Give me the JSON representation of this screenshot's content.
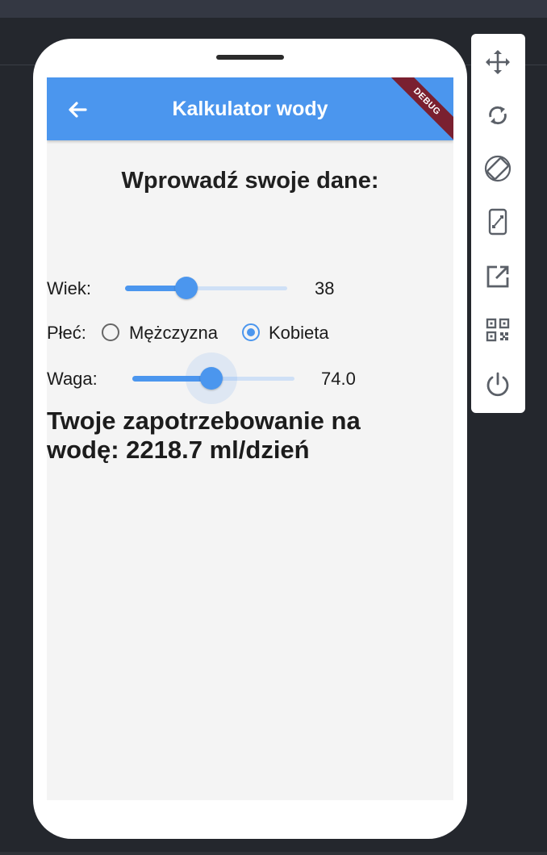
{
  "app_bar": {
    "title": "Kalkulator wody",
    "debug_label": "DEBUG"
  },
  "heading": "Wprowadź swoje dane:",
  "age": {
    "label": "Wiek:",
    "value_text": "38",
    "slider_fraction": 0.38
  },
  "gender": {
    "label": "Płeć:",
    "options": [
      "Mężczyzna",
      "Kobieta"
    ],
    "selected": "Kobieta"
  },
  "weight": {
    "label": "Waga:",
    "value_text": "74.0",
    "slider_fraction": 0.49
  },
  "result": "Twoje zapotrzebowanie na wodę: 2218.7 ml/dzień",
  "colors": {
    "primary": "#4b96ee",
    "debug_banner": "#7a2030",
    "screen_background": "#f4f4f4",
    "ide_background": "#24272d"
  },
  "toolbar": {
    "icons": [
      "move-icon",
      "rotate-icon",
      "rotate-device-icon",
      "resize-device-icon",
      "open-external-icon",
      "qr-code-icon",
      "power-icon"
    ]
  }
}
